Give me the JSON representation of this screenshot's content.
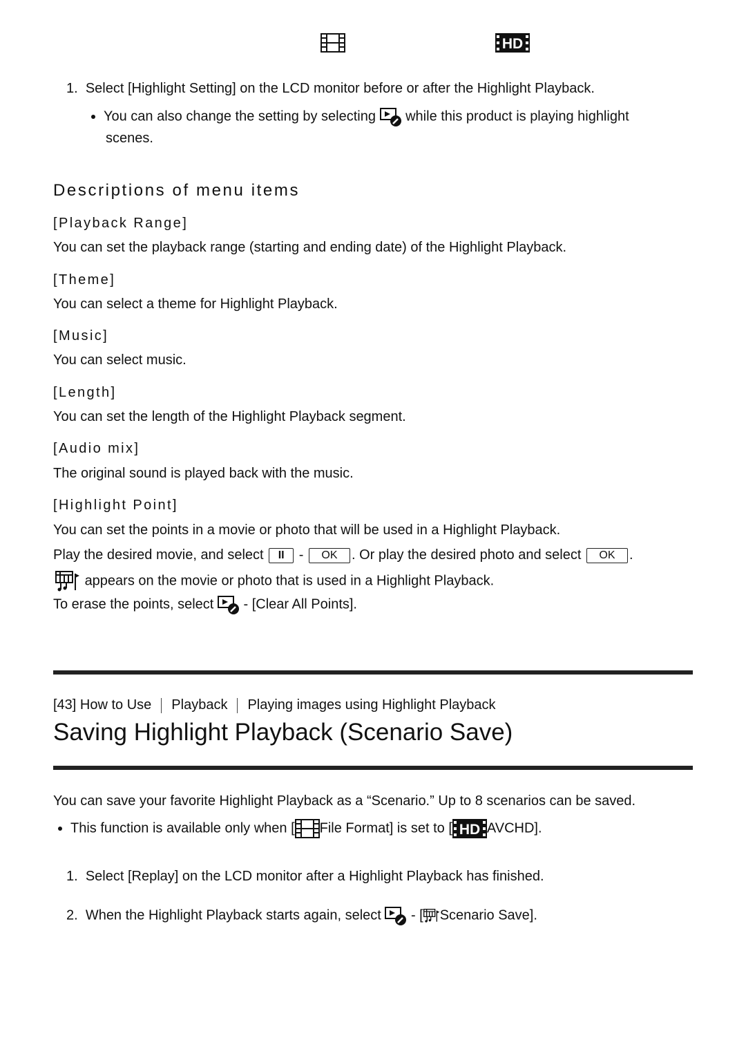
{
  "top_icons": [
    "film-icon",
    "hd-film-icon"
  ],
  "section1": {
    "step1": {
      "num": "1.",
      "text": "Select [Highlight Setting] on the LCD monitor before or after the Highlight Playback."
    },
    "note": {
      "before": "You can also change the setting by selecting",
      "icon": "playback-settings-icon",
      "after": "while this product is playing highlight",
      "line2": "scenes."
    },
    "heading": "Descriptions of menu items",
    "items": [
      {
        "label": "[Playback Range]",
        "desc": "You can set the playback range (starting and ending date) of the Highlight Playback."
      },
      {
        "label": "[Theme]",
        "desc": "You can select a theme for Highlight Playback."
      },
      {
        "label": "[Music]",
        "desc": "You can select music."
      },
      {
        "label": "[Length]",
        "desc": "You can set the length of the Highlight Playback segment."
      },
      {
        "label": "[Audio mix]",
        "desc": "The original sound is played back with the music."
      },
      {
        "label": "[Highlight Point]",
        "desc": "You can set the points in a movie or photo that will be used in a Highlight Playback."
      }
    ],
    "hp_line2": {
      "a": "Play the desired movie, and select",
      "pause": "II",
      "dash": "-",
      "ok": "OK",
      "b": ". Or play the desired photo and select",
      "ok2": "OK",
      "c": "."
    },
    "hp_line3": "appears on the movie or photo that is used in a Highlight Playback.",
    "hp_line4": {
      "a": "To erase the points, select",
      "b": "- [Clear All Points]."
    }
  },
  "section2": {
    "breadcrumb": [
      "[43] How to Use",
      "Playback",
      "Playing images using Highlight Playback"
    ],
    "title": "Saving Highlight Playback (Scenario Save)",
    "intro": "You can save your favorite Highlight Playback as a “Scenario.” Up to 8 scenarios can be saved.",
    "note": {
      "a": "This function is available only when [",
      "b": "File Format] is set to [",
      "c": "AVCHD]."
    },
    "step1": {
      "num": "1.",
      "text": "Select [Replay] on the LCD monitor after a Highlight Playback has finished."
    },
    "step2": {
      "num": "2.",
      "a": "When the Highlight Playback starts again, select",
      "b": "- [",
      "c": "Scenario Save]."
    }
  }
}
